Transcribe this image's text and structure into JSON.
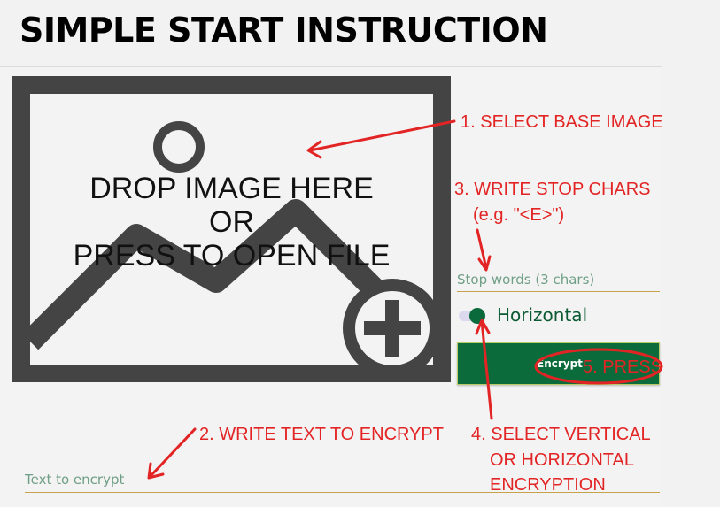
{
  "title": "SIMPLE START INSTRUCTION",
  "dropzone": {
    "line1": "DROP IMAGE HERE",
    "line2": "OR",
    "line3": "PRESS TO OPEN FILE",
    "icon": "add-image-icon"
  },
  "stop_words": {
    "placeholder": "Stop words (3 chars)",
    "value": ""
  },
  "orientation_toggle": {
    "label": "Horizontal",
    "checked": true
  },
  "encrypt_button": {
    "label": "Encrypt"
  },
  "text_to_encrypt": {
    "placeholder": "Text to encrypt",
    "value": ""
  },
  "annotations": {
    "step1": "1. SELECT BASE IMAGE",
    "step2": "2. WRITE TEXT TO ENCRYPT",
    "step3_line1": "3. WRITE STOP CHARS",
    "step3_line2": "(e.g. \"<E>\")",
    "step4_line1": "4. SELECT VERTICAL",
    "step4_line2": "OR HORIZONTAL",
    "step4_line3": "ENCRYPTION",
    "step5": "5. PRESS"
  },
  "colors": {
    "accent_green": "#0c6b3b",
    "annotation_red": "#e32424",
    "underline_gold": "#c8a24a",
    "placeholder_green": "#6f9f86"
  }
}
